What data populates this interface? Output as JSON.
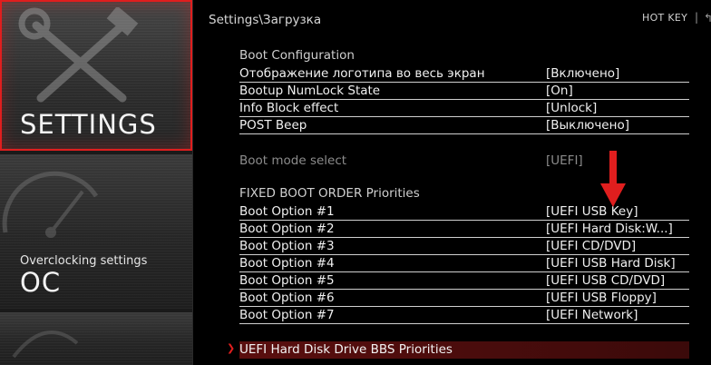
{
  "header": {
    "breadcrumb": "Settings\\Загрузка",
    "hotkey_label": "HOT KEY",
    "separator": "|"
  },
  "left_menu": {
    "settings_label": "SETTINGS",
    "oc_subtitle": "Overclocking settings",
    "oc_label": "OC"
  },
  "sections": {
    "boot_configuration": "Boot Configuration",
    "fixed_boot_order": "FIXED BOOT ORDER Priorities"
  },
  "boot_config_rows": [
    {
      "name": "Отображение логотипа во весь экран",
      "value": "[Включено]"
    },
    {
      "name": "Bootup NumLock State",
      "value": "[On]"
    },
    {
      "name": "Info Block effect",
      "value": "[Unlock]"
    },
    {
      "name": "POST Beep",
      "value": "[Выключено]"
    }
  ],
  "boot_mode": {
    "name": "Boot mode select",
    "value": "[UEFI]"
  },
  "boot_options": [
    {
      "name": "Boot Option #1",
      "value": "[UEFI USB Key]"
    },
    {
      "name": "Boot Option #2",
      "value": "[UEFI Hard Disk:W...]"
    },
    {
      "name": "Boot Option #3",
      "value": "[UEFI CD/DVD]"
    },
    {
      "name": "Boot Option #4",
      "value": "[UEFI USB Hard Disk]"
    },
    {
      "name": "Boot Option #5",
      "value": "[UEFI USB CD/DVD]"
    },
    {
      "name": "Boot Option #6",
      "value": "[UEFI USB Floppy]"
    },
    {
      "name": "Boot Option #7",
      "value": "[UEFI Network]"
    }
  ],
  "bbs_priorities": {
    "label": "UEFI Hard Disk Drive BBS Priorities"
  },
  "colors": {
    "accent": "#e01e1e",
    "background": "#000000",
    "text": "#f0f0f0",
    "disabled": "#8c8c8c"
  },
  "icons": [
    "tools-icon",
    "gauge-icon",
    "chevron-right-icon",
    "down-arrow-icon",
    "back-icon"
  ]
}
